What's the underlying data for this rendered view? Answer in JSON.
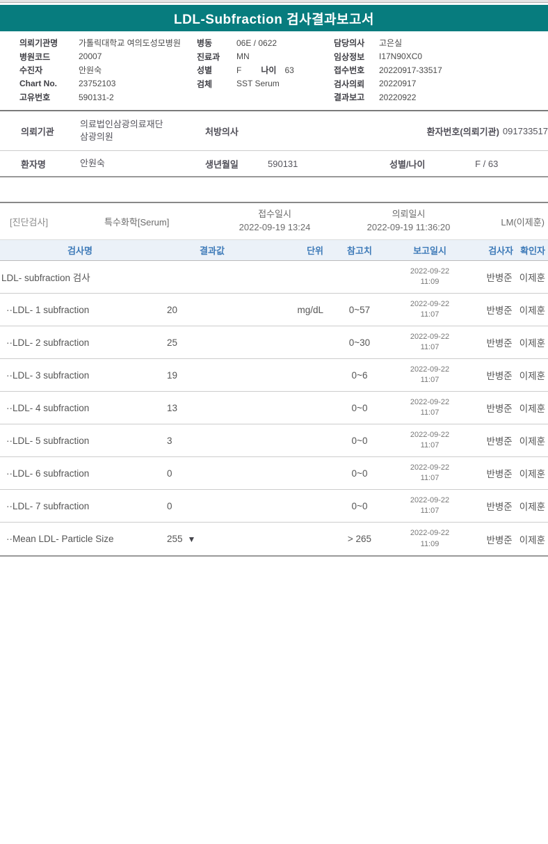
{
  "colors": {
    "header_bg": "#077C7E",
    "header_text": "#FFFFFF",
    "table_header_bg": "#EBF1F8",
    "table_header_text": "#3D7AB8",
    "flag_color": "#43434A"
  },
  "header": {
    "title": "LDL-Subfraction 검사결과보고서"
  },
  "patient_info": {
    "left": [
      {
        "label": "의뢰기관명",
        "value": "가톨릭대학교 여의도성모병원"
      },
      {
        "label": "병원코드",
        "value": "20007"
      },
      {
        "label": "수진자",
        "value": "안원숙"
      },
      {
        "label": "Chart No.",
        "value": "23752103"
      },
      {
        "label": "고유번호",
        "value": "590131-2"
      }
    ],
    "middle": [
      {
        "label": "병동",
        "value": "06E / 0622"
      },
      {
        "label": "진료과",
        "value": "MN"
      },
      {
        "label": "성별",
        "value": "F",
        "label2": "나이",
        "value2": "63"
      },
      {
        "label": "검체",
        "value": "SST Serum"
      }
    ],
    "right": [
      {
        "label": "담당의사",
        "value": "고은실"
      },
      {
        "label": "임상정보",
        "value": "I17N90XC0"
      },
      {
        "label": "접수번호",
        "value": "20220917-33517"
      },
      {
        "label": "검사의뢰",
        "value": "20220917"
      },
      {
        "label": "결과보고",
        "value": "20220922"
      }
    ]
  },
  "referral": {
    "agency_label": "의뢰기관",
    "agency_line1": "의료법인삼광의료재단",
    "agency_line2": "삼광의원",
    "physician_label": "처방의사",
    "physician_value": "",
    "patient_no_label": "환자번호(의뢰기관)",
    "patient_no_value": "091733517",
    "patient_name_label": "환자명",
    "patient_name_value": "안원숙",
    "birth_label": "생년월일",
    "birth_value": "590131",
    "sex_age_label": "성별/나이",
    "sex_age_value": "F / 63"
  },
  "test_section": {
    "category": "[진단검사]",
    "department": "특수화학[Serum]",
    "received_label": "접수일시",
    "received_value": "2022-09-19  13:24",
    "requested_label": "의뢰일시",
    "requested_value": "2022-09-19  11:36:20",
    "lab": "LM(이제훈)"
  },
  "table": {
    "headers": {
      "name": "검사명",
      "result": "결과값",
      "unit": "단위",
      "reference": "참고치",
      "reported": "보고일시",
      "tester": "검사자",
      "verifier": "확인자"
    },
    "rows": [
      {
        "name": "LDL- subfraction 검사",
        "result": "",
        "flag": "",
        "unit": "",
        "reference": "",
        "report_date": "2022-09-22",
        "report_time": "11:09",
        "tester": "반병준",
        "verifier": "이제훈"
      },
      {
        "name": "··LDL- 1 subfraction",
        "result": "20",
        "flag": "",
        "unit": "mg/dL",
        "reference": "0~57",
        "report_date": "2022-09-22",
        "report_time": "11:07",
        "tester": "반병준",
        "verifier": "이제훈"
      },
      {
        "name": "··LDL- 2 subfraction",
        "result": "25",
        "flag": "",
        "unit": "",
        "reference": "0~30",
        "report_date": "2022-09-22",
        "report_time": "11:07",
        "tester": "반병준",
        "verifier": "이제훈"
      },
      {
        "name": "··LDL- 3 subfraction",
        "result": "19",
        "flag": "",
        "unit": "",
        "reference": "0~6",
        "report_date": "2022-09-22",
        "report_time": "11:07",
        "tester": "반병준",
        "verifier": "이제훈"
      },
      {
        "name": "··LDL- 4 subfraction",
        "result": "13",
        "flag": "",
        "unit": "",
        "reference": "0~0",
        "report_date": "2022-09-22",
        "report_time": "11:07",
        "tester": "반병준",
        "verifier": "이제훈"
      },
      {
        "name": "··LDL- 5 subfraction",
        "result": "3",
        "flag": "",
        "unit": "",
        "reference": "0~0",
        "report_date": "2022-09-22",
        "report_time": "11:07",
        "tester": "반병준",
        "verifier": "이제훈"
      },
      {
        "name": "··LDL- 6 subfraction",
        "result": "0",
        "flag": "",
        "unit": "",
        "reference": "0~0",
        "report_date": "2022-09-22",
        "report_time": "11:07",
        "tester": "반병준",
        "verifier": "이제훈"
      },
      {
        "name": "··LDL- 7 subfraction",
        "result": "0",
        "flag": "",
        "unit": "",
        "reference": "0~0",
        "report_date": "2022-09-22",
        "report_time": "11:07",
        "tester": "반병준",
        "verifier": "이제훈"
      },
      {
        "name": "··Mean LDL- Particle Size",
        "result": "255",
        "flag": "▼",
        "unit": "",
        "reference": "> 265",
        "report_date": "2022-09-22",
        "report_time": "11:09",
        "tester": "반병준",
        "verifier": "이제훈"
      }
    ]
  }
}
